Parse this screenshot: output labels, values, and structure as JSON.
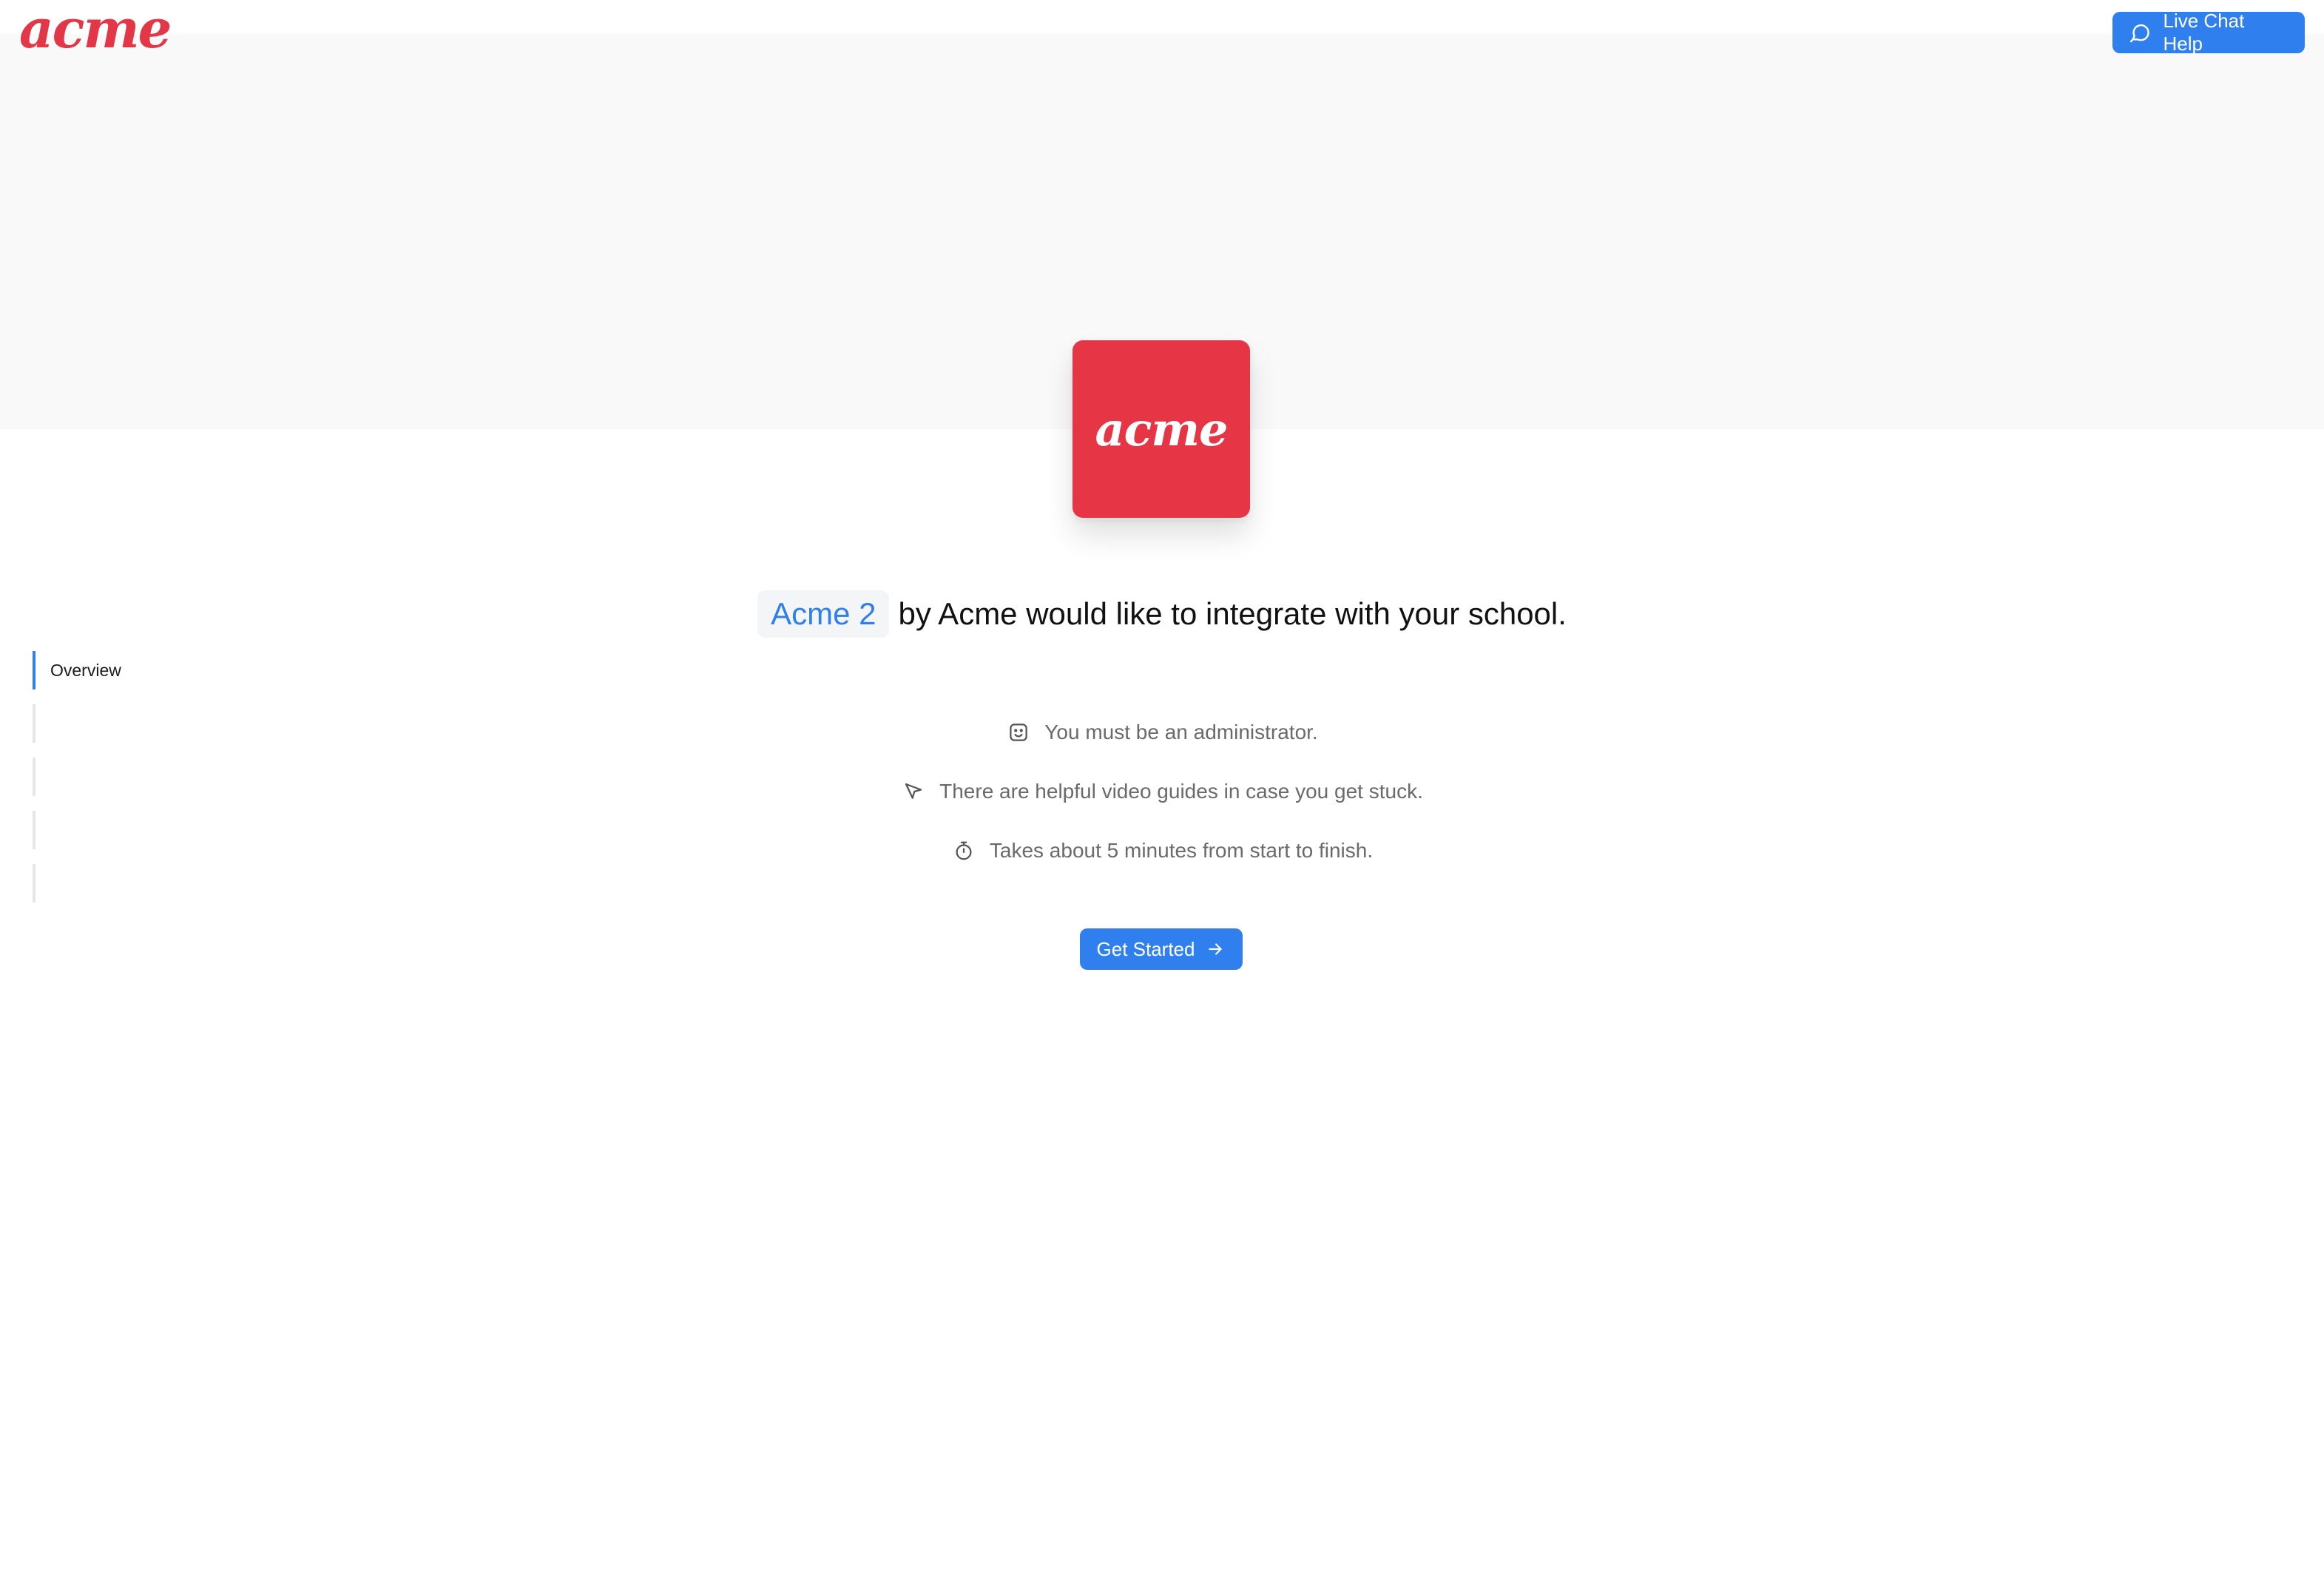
{
  "header": {
    "brand_logo_text": "acme",
    "live_chat_label": "Live Chat Help",
    "live_chat_icon": "chat-bubble-icon"
  },
  "app_tile": {
    "logo_text": "acme",
    "color": "#e63646"
  },
  "headline": {
    "app_name": "Acme 2",
    "text": "by Acme would like to integrate with your school."
  },
  "steps": {
    "items": [
      {
        "label": "Overview",
        "active": true
      },
      {
        "label": "",
        "active": false
      },
      {
        "label": "",
        "active": false
      },
      {
        "label": "",
        "active": false
      },
      {
        "label": "",
        "active": false
      }
    ]
  },
  "requirements": [
    {
      "icon": "smiley-face-icon",
      "text": "You must be an administrator."
    },
    {
      "icon": "cursor-pointer-icon",
      "text": "There are helpful video guides in case you get stuck."
    },
    {
      "icon": "stopwatch-icon",
      "text": "Takes about 5 minutes from start to finish."
    }
  ],
  "cta": {
    "label": "Get Started",
    "icon": "arrow-right-icon"
  },
  "colors": {
    "accent": "#2f7fef",
    "brand": "#e33747",
    "hero_bg": "#f9f9f9",
    "muted_text": "#6a6a6a"
  }
}
